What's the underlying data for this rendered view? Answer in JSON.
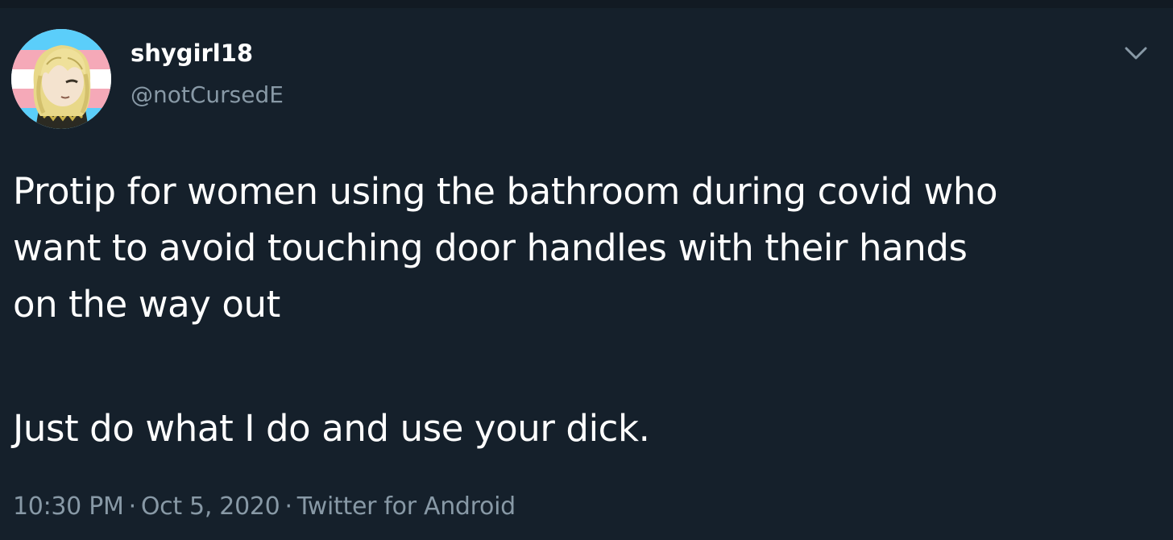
{
  "user": {
    "display_name": "shygirl18",
    "handle": "@notCursedE"
  },
  "tweet": {
    "lines": [
      "Protip for women using the bathroom during covid who",
      "want to avoid touching door handles with their hands",
      "on the way out",
      "Just do what I do and use your dick."
    ],
    "time": "10:30 PM",
    "date": "Oct 5, 2020",
    "source": "Twitter for Android",
    "separator": "·"
  },
  "icons": {
    "menu": "chevron-down-icon"
  },
  "colors": {
    "background": "#15202b",
    "text": "#ffffff",
    "secondary": "#8899a6"
  }
}
